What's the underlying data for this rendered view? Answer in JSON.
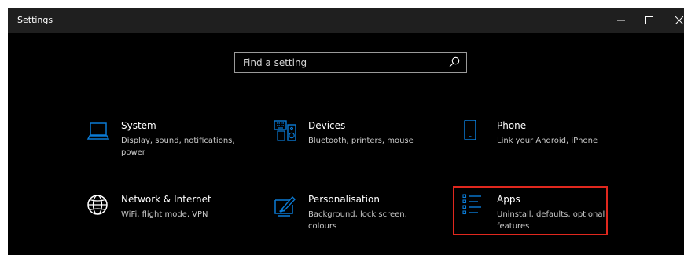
{
  "window": {
    "title": "Settings",
    "minimize_glyph": "—",
    "maximize_glyph": "☐",
    "close_glyph": "✕"
  },
  "search": {
    "placeholder": "Find a setting",
    "icon": "search-icon"
  },
  "accent_color": "#0a7bd6",
  "highlight_color": "#e0281e",
  "tiles": [
    {
      "title": "System",
      "description": "Display, sound, notifications, power",
      "icon": "laptop-icon"
    },
    {
      "title": "Devices",
      "description": "Bluetooth, printers, mouse",
      "icon": "keyboard-speaker-icon"
    },
    {
      "title": "Phone",
      "description": "Link your Android, iPhone",
      "icon": "phone-icon"
    },
    {
      "title": "Network & Internet",
      "description": "WiFi, flight mode, VPN",
      "icon": "globe-icon"
    },
    {
      "title": "Personalisation",
      "description": "Background, lock screen, colours",
      "icon": "paintbrush-icon"
    },
    {
      "title": "Apps",
      "description": "Uninstall, defaults, optional features",
      "icon": "apps-list-icon"
    }
  ]
}
